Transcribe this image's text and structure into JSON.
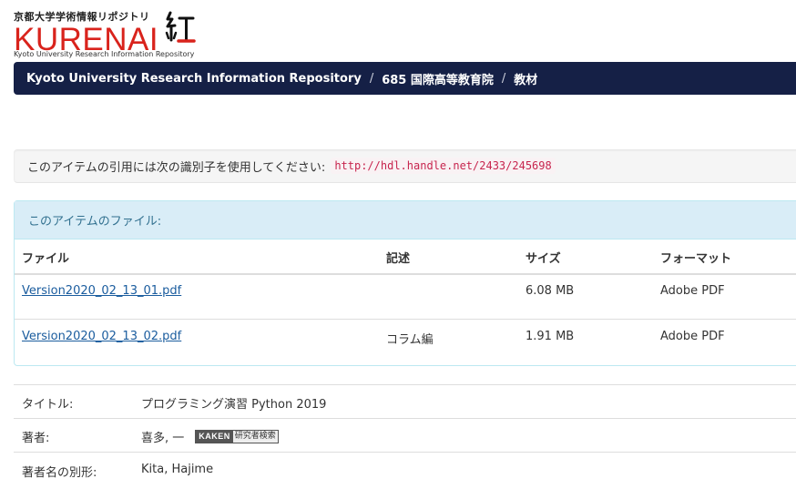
{
  "logo": {
    "jp_name": "京都大学学術情報リポジトリ",
    "wordmark": "KURENAI",
    "subtitle": "Kyoto University Research Information Repository",
    "kanji": "紅"
  },
  "breadcrumb": {
    "items": [
      "Kyoto University Research Information Repository",
      "685 国際高等教育院",
      "教材"
    ],
    "separator": "/"
  },
  "citation": {
    "label": "このアイテムの引用には次の識別子を使用してください:",
    "handle": "http://hdl.handle.net/2433/245698"
  },
  "files": {
    "panel_title": "このアイテムのファイル:",
    "columns": [
      "ファイル",
      "記述",
      "サイズ",
      "フォーマット"
    ],
    "rows": [
      {
        "file": "Version2020_02_13_01.pdf",
        "description": "",
        "size": "6.08 MB",
        "format": "Adobe PDF"
      },
      {
        "file": "Version2020_02_13_02.pdf",
        "description": "コラム編",
        "size": "1.91 MB",
        "format": "Adobe PDF"
      }
    ]
  },
  "metadata": {
    "rows": [
      {
        "key": "タイトル:",
        "value": "プログラミング演習 Python 2019"
      },
      {
        "key": "著者:",
        "value": "喜多, 一"
      },
      {
        "key": "著者名の別形:",
        "value": "Kita, Hajime"
      }
    ],
    "kaken_badge": {
      "left": "KAKEN",
      "right": "研究者検索"
    }
  },
  "colors": {
    "brand_red": "#d9231c",
    "nav_bg": "#152046",
    "link": "#1a5c9e",
    "code": "#c7254e",
    "panel_head_bg": "#d9edf7",
    "panel_head_text": "#31708f"
  }
}
